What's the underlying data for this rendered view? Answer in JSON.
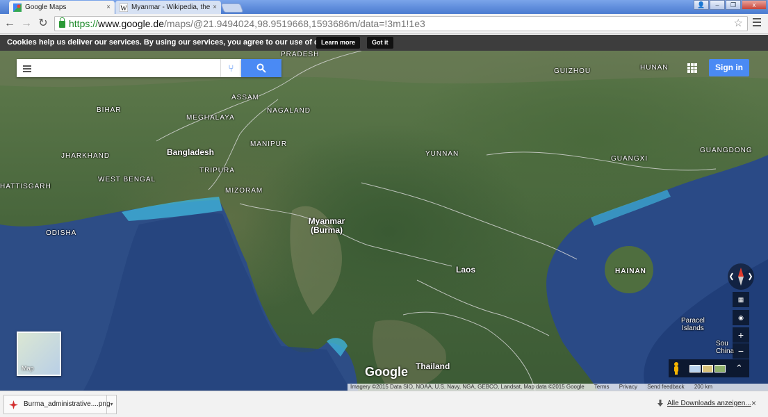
{
  "browser": {
    "tabs": [
      {
        "title": "Google Maps",
        "active": true
      },
      {
        "title": "Myanmar - Wikipedia, the fr",
        "active": false
      }
    ],
    "url": {
      "scheme": "https://",
      "host": "www.google.de",
      "path": "/maps/@21.9494024,98.9519668,1593686m/data=!3m1!1e3"
    },
    "close_glyph": "×",
    "window_controls": {
      "user": "👤",
      "minimize": "–",
      "restore": "❐",
      "close": "x"
    }
  },
  "cookie_bar": {
    "text": "Cookies help us deliver our services. By using our services, you agree to our use of cookies.",
    "learn_more": "Learn more",
    "got_it": "Got it"
  },
  "map": {
    "search": {
      "value": "",
      "placeholder": ""
    },
    "sign_in": "Sign in",
    "minimap_label": "Map",
    "watermark": "Google",
    "labels": [
      {
        "name": "pradesh",
        "text": "PRADESH"
      },
      {
        "name": "assam",
        "text": "ASSAM"
      },
      {
        "name": "bihar",
        "text": "BIHAR"
      },
      {
        "name": "meghalaya",
        "text": "MEGHALAYA"
      },
      {
        "name": "nagaland",
        "text": "NAGALAND"
      },
      {
        "name": "manipur",
        "text": "MANIPUR"
      },
      {
        "name": "jharkhand",
        "text": "JHARKHAND"
      },
      {
        "name": "tripura",
        "text": "TRIPURA"
      },
      {
        "name": "west-bengal",
        "text": "WEST BENGAL"
      },
      {
        "name": "mizoram",
        "text": "MIZORAM"
      },
      {
        "name": "chhattisgarh",
        "text": "HATTISGARH"
      },
      {
        "name": "odisha",
        "text": "ODISHA"
      },
      {
        "name": "guizhou",
        "text": "GUIZHOU"
      },
      {
        "name": "hunan",
        "text": "HUNAN"
      },
      {
        "name": "yunnan",
        "text": "YUNNAN"
      },
      {
        "name": "guangxi",
        "text": "GUANGXI"
      },
      {
        "name": "guangdong",
        "text": "GUANGDONG"
      },
      {
        "name": "south-china",
        "text": "Sou China"
      }
    ],
    "bold_labels": [
      {
        "name": "bangladesh",
        "text": "Bangladesh"
      },
      {
        "name": "laos",
        "text": "Laos"
      },
      {
        "name": "thailand",
        "text": "Thailand"
      },
      {
        "name": "hainan",
        "text": "HAINAN"
      }
    ],
    "myanmar": {
      "line1": "Myanmar",
      "line2": "(Burma)"
    },
    "paracel": {
      "line1": "Paracel",
      "line2": "Islands"
    },
    "controls": {
      "zoom_in": "+",
      "zoom_out": "−",
      "collapse": "⌃"
    },
    "footer": {
      "imagery": "Imagery ©2015 Data SIO, NOAA, U.S. Navy, NGA, GEBCO, Landsat, Map data ©2015 Google",
      "terms": "Terms",
      "privacy": "Privacy",
      "feedback": "Send feedback",
      "scale": "200 km"
    }
  },
  "downloads": {
    "file": "Burma_administrative....png",
    "dropdown": "▾",
    "all": "Alle Downloads anzeigen...",
    "close": "×"
  }
}
